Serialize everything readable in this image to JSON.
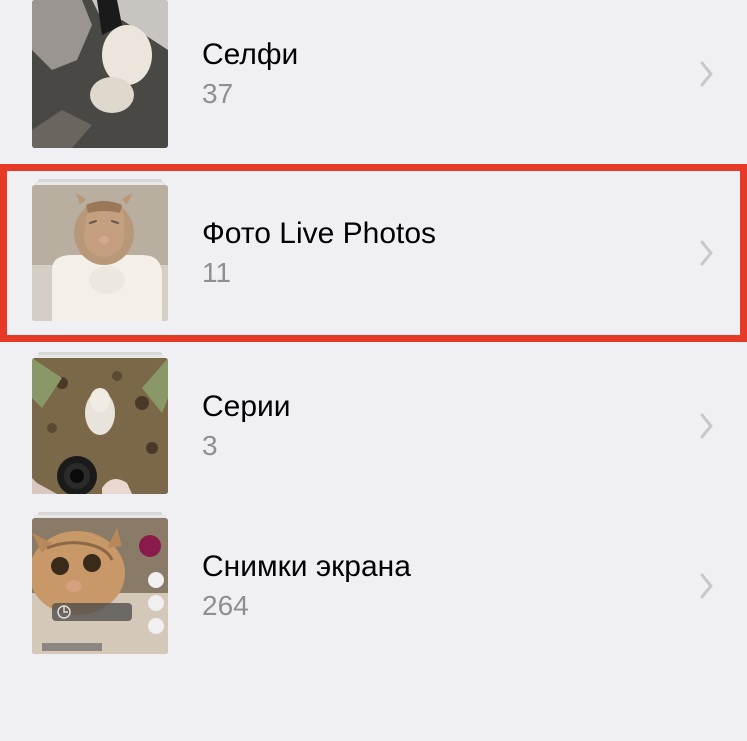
{
  "albums": [
    {
      "title": "Селфи",
      "count": "37",
      "highlighted": false
    },
    {
      "title": "Фото Live Photos",
      "count": "11",
      "highlighted": true
    },
    {
      "title": "Серии",
      "count": "3",
      "highlighted": false
    },
    {
      "title": "Снимки экрана",
      "count": "264",
      "highlighted": false
    }
  ],
  "highlight_color": "#e63a27"
}
